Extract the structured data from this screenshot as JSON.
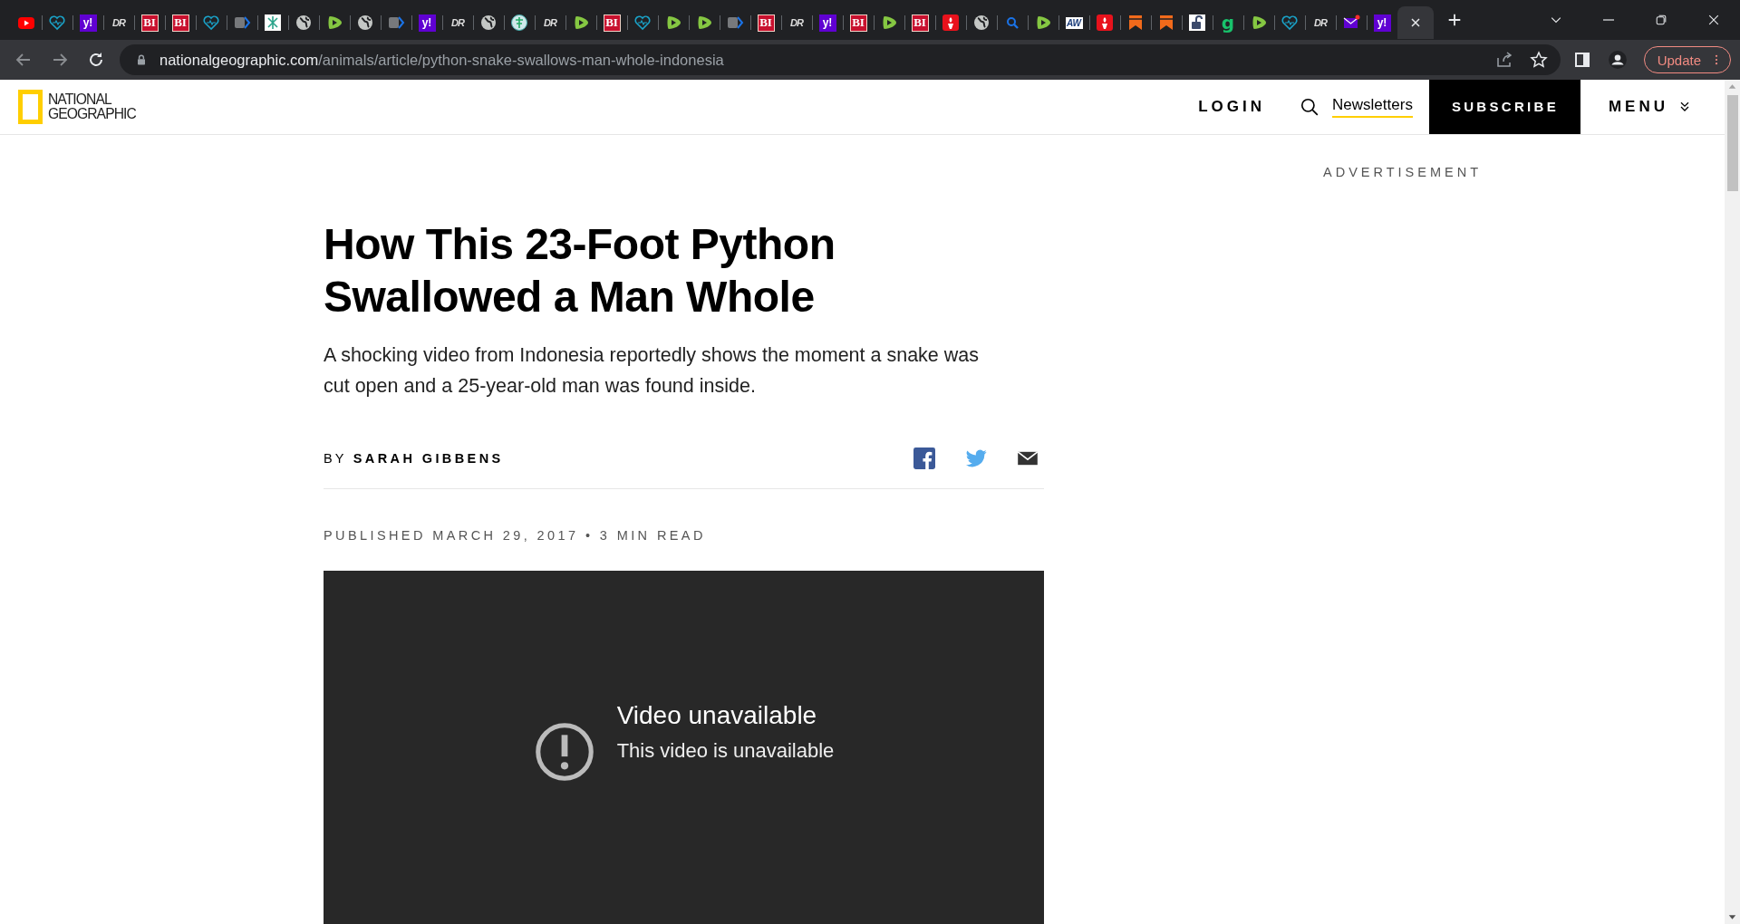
{
  "browser": {
    "tabs": [
      {
        "kind": "youtube",
        "selected": false
      },
      {
        "kind": "heart",
        "selected": false
      },
      {
        "kind": "yahoo",
        "glyph": "y!",
        "selected": false
      },
      {
        "kind": "dr",
        "glyph": "DR",
        "selected": false
      },
      {
        "kind": "bi",
        "glyph": "BI",
        "selected": false
      },
      {
        "kind": "bi",
        "glyph": "BI",
        "selected": false
      },
      {
        "kind": "heart",
        "selected": false
      },
      {
        "kind": "arrow",
        "selected": false
      },
      {
        "kind": "sheet",
        "selected": false
      },
      {
        "kind": "globe",
        "selected": false
      },
      {
        "kind": "rumble",
        "selected": false
      },
      {
        "kind": "globe",
        "selected": false
      },
      {
        "kind": "arrow",
        "selected": false
      },
      {
        "kind": "yahoo",
        "glyph": "y!",
        "selected": false
      },
      {
        "kind": "dr",
        "glyph": "DR",
        "selected": false
      },
      {
        "kind": "globe",
        "selected": false
      },
      {
        "kind": "badge",
        "selected": false
      },
      {
        "kind": "dr",
        "glyph": "DR",
        "selected": false
      },
      {
        "kind": "rumble",
        "selected": false
      },
      {
        "kind": "bi",
        "glyph": "BI",
        "selected": false
      },
      {
        "kind": "heart",
        "selected": false
      },
      {
        "kind": "rumble",
        "selected": false
      },
      {
        "kind": "rumble",
        "selected": false
      },
      {
        "kind": "arrow",
        "selected": false
      },
      {
        "kind": "bi",
        "glyph": "BI",
        "selected": false
      },
      {
        "kind": "dr",
        "glyph": "DR",
        "selected": false
      },
      {
        "kind": "yahoo",
        "glyph": "y!",
        "selected": false
      },
      {
        "kind": "bi",
        "glyph": "BI",
        "selected": false
      },
      {
        "kind": "rumble",
        "selected": false
      },
      {
        "kind": "bi",
        "glyph": "BI",
        "selected": false
      },
      {
        "kind": "torch",
        "selected": false
      },
      {
        "kind": "globe",
        "selected": false
      },
      {
        "kind": "search",
        "selected": false
      },
      {
        "kind": "rumble",
        "selected": false
      },
      {
        "kind": "aw",
        "glyph": "AW",
        "selected": false
      },
      {
        "kind": "torch",
        "selected": false
      },
      {
        "kind": "bookmark",
        "selected": false
      },
      {
        "kind": "bookmark",
        "selected": false
      },
      {
        "kind": "lock",
        "selected": false
      },
      {
        "kind": "g",
        "glyph": "g",
        "selected": false
      },
      {
        "kind": "rumble",
        "selected": false
      },
      {
        "kind": "heart",
        "selected": false
      },
      {
        "kind": "dr",
        "glyph": "DR",
        "selected": false
      },
      {
        "kind": "mail",
        "selected": false
      },
      {
        "kind": "yahoo",
        "glyph": "y!",
        "selected": false
      },
      {
        "selected": true
      }
    ],
    "url_host": "nationalgeographic.com",
    "url_path": "/animals/article/python-snake-swallows-man-whole-indonesia",
    "update_button": "Update"
  },
  "header": {
    "logo_line1": "NATIONAL",
    "logo_line2": "GEOGRAPHIC",
    "login": "LOGIN",
    "newsletters": "Newsletters",
    "subscribe": "SUBSCRIBE",
    "menu": "MENU"
  },
  "sidebar": {
    "advertisement": "ADVERTISEMENT"
  },
  "article": {
    "title": "How This 23-Foot Python Swallowed a Man Whole",
    "dek": "A shocking video from Indonesia reportedly shows the moment a snake was cut open and a 25-year-old man was found inside.",
    "byline_prefix": "BY",
    "author": "SARAH GIBBENS",
    "published": "PUBLISHED MARCH 29, 2017 • 3 MIN READ",
    "video": {
      "heading": "Video unavailable",
      "message": "This video is unavailable"
    }
  }
}
